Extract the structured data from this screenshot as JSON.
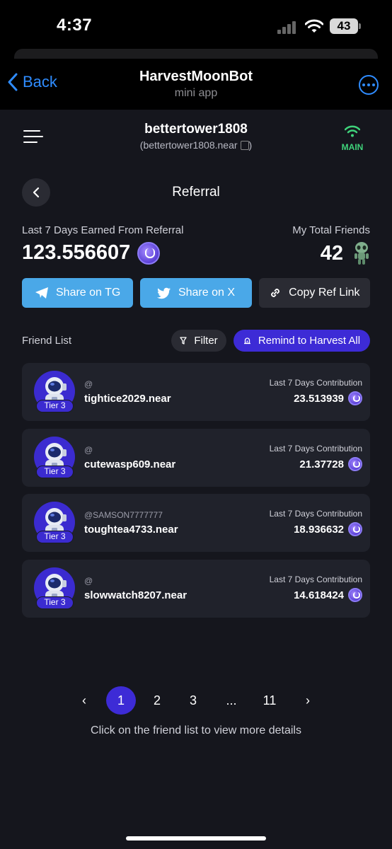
{
  "status_bar": {
    "time": "4:37",
    "battery": "43"
  },
  "telegram": {
    "back_label": "Back",
    "title": "HarvestMoonBot",
    "subtitle": "mini app"
  },
  "account": {
    "username": "bettertower1808",
    "account_id": "(bettertower1808.near",
    "network": "MAIN"
  },
  "page": {
    "title": "Referral"
  },
  "stats": {
    "earned_label": "Last 7 Days Earned From Referral",
    "earned_value": "123.556607",
    "friends_label": "My Total Friends",
    "friends_value": "42"
  },
  "share": {
    "tg": "Share on TG",
    "x": "Share on X",
    "copy": "Copy Ref Link"
  },
  "friend_list": {
    "label": "Friend List",
    "filter": "Filter",
    "remind": "Remind to Harvest All",
    "contribution_label": "Last 7 Days Contribution",
    "items": [
      {
        "tier": "Tier 3",
        "handle": "@",
        "name": "tightice2029.near",
        "contribution": "23.513939"
      },
      {
        "tier": "Tier 3",
        "handle": "@",
        "name": "cutewasp609.near",
        "contribution": "21.37728"
      },
      {
        "tier": "Tier 3",
        "handle": "@SAMSON7777777",
        "name": "toughtea4733.near",
        "contribution": "18.936632"
      },
      {
        "tier": "Tier 3",
        "handle": "@",
        "name": "slowwatch8207.near",
        "contribution": "14.618424"
      }
    ]
  },
  "pagination": {
    "prev": "‹",
    "pages": [
      "1",
      "2",
      "3",
      "...",
      "11"
    ],
    "next": "›",
    "current": "1"
  },
  "hint": "Click on the friend list to view more details",
  "colors": {
    "accent": "#3d2bd6",
    "share_blue": "#4aa8e8",
    "link_blue": "#2f8cff",
    "network_green": "#3fd27a",
    "background": "#15161d",
    "card": "#20222b"
  }
}
